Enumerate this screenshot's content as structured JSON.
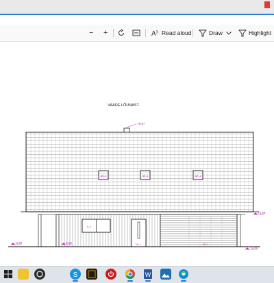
{
  "toolbar": {
    "zoom_out": "−",
    "zoom_in": "+",
    "read_aloud_label": "Read aloud",
    "draw_label": "Draw",
    "highlight_label": "Highlight"
  },
  "drawing": {
    "title": "VAADE LÕUNAST",
    "elevations": {
      "ridge": "+8,57",
      "eave": "+2,25",
      "left_ground": "-0,95",
      "zero": "0,00",
      "right_ground": "-0,40"
    },
    "window_tags": [
      "AK-1",
      "AK-1",
      "AK-1"
    ],
    "door_tags": [
      "A-3",
      "UK-1",
      "SD-1"
    ]
  },
  "taskbar": {
    "apps": [
      "start",
      "search",
      "task-view",
      "file-explorer",
      "obs",
      "skype",
      "photoshop",
      "power",
      "chrome",
      "word",
      "photos",
      "edge"
    ]
  },
  "colors": {
    "accent": "#2b7fd6",
    "annotation": "#d63ad6",
    "line": "#000000"
  }
}
